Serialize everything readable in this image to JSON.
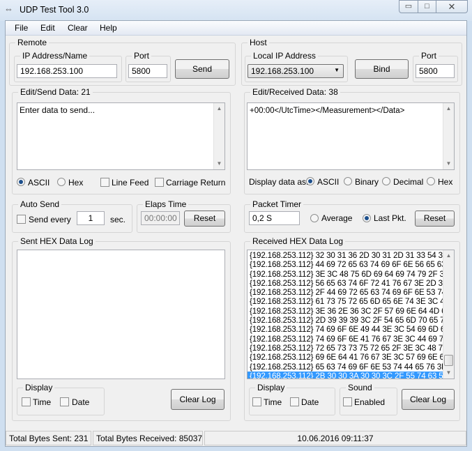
{
  "window": {
    "title": "UDP Test Tool 3.0",
    "controls": [
      "minimize",
      "maximize",
      "close"
    ]
  },
  "menu": [
    "File",
    "Edit",
    "Clear",
    "Help"
  ],
  "remote": {
    "label": "Remote",
    "ip_label": "IP Address/Name",
    "ip_value": "192.168.253.100",
    "port_label": "Port",
    "port_value": "5800",
    "send_label": "Send"
  },
  "host": {
    "label": "Host",
    "local_ip_label": "Local IP Address",
    "local_ip_value": "192.168.253.100",
    "bind_label": "Bind",
    "port_label": "Port",
    "port_value": "5800"
  },
  "edit_send": {
    "label": "Edit/Send Data: 21",
    "placeholder": "Enter data to send...",
    "ascii": "ASCII",
    "hex": "Hex",
    "line_feed": "Line Feed",
    "carriage_return": "Carriage Return",
    "selected": "ASCII"
  },
  "edit_received": {
    "label": "Edit/Received Data: 38",
    "text": "+00:00</UtcTime></Measurement></Data>",
    "display_as": "Display data as:",
    "options": [
      "ASCII",
      "Binary",
      "Decimal",
      "Hex"
    ],
    "selected": "ASCII"
  },
  "auto_send": {
    "label": "Auto Send",
    "send_every": "Send every",
    "interval": "1",
    "unit": "sec."
  },
  "elaps_time": {
    "label": "Elaps Time",
    "value": "00:00:00",
    "reset": "Reset"
  },
  "packet_timer": {
    "label": "Packet Timer",
    "value": "0,2 S",
    "average": "Average",
    "last_pkt": "Last Pkt.",
    "selected": "Last Pkt.",
    "reset": "Reset"
  },
  "sent_log": {
    "label": "Sent HEX Data Log",
    "display_label": "Display",
    "time": "Time",
    "date": "Date",
    "clear_log": "Clear Log"
  },
  "received_log": {
    "label": "Received HEX Data Log",
    "lines": [
      "{192.168.253.112} 32 30 31 36 2D 30 31 2D 31 33 54 31 3",
      "{192.168.253.112} 44 69 72 65 63 74 69 6F 6E 56 65 63 7",
      "{192.168.253.112} 3E 3C 48 75 6D 69 64 69 74 79 2F 3E",
      "{192.168.253.112} 56 65 63 74 6F 72 41 76 67 3E 2D 39 3",
      "{192.168.253.112} 2F 44 69 72 65 63 74 69 6F 6E 53 74 4",
      "{192.168.253.112} 61 73 75 72 65 6D 65 6E 74 3E 3C 4D",
      "{192.168.253.112} 3E 36 2E 36 3C 2F 57 69 6E 64 4D 61",
      "{192.168.253.112} 2D 39 39 39 3C 2F 54 65 6D 70 65 72",
      "{192.168.253.112} 74 69 6F 6E 49 44 3E 3C 54 69 6D 65",
      "{192.168.253.112} 74 69 6F 6E 41 76 67 3E 3C 44 69 72 6",
      "{192.168.253.112} 72 65 73 73 75 72 65 2F 3E 3C 48 75 6",
      "{192.168.253.112} 69 6E 64 41 76 67 3E 3C 57 69 6E 64 5",
      "{192.168.253.112} 65 63 74 69 6F 6E 53 74 44 65 76 3E 3",
      "{192.168.253.112} 2B 30 30 3A 30 30 3C 2F 55 74 63 54 6"
    ],
    "selected_index": 13,
    "display_label": "Display",
    "time": "Time",
    "date": "Date",
    "sound_label": "Sound",
    "enabled": "Enabled",
    "clear_log": "Clear Log"
  },
  "status": {
    "sent": "Total Bytes Sent: 231",
    "received": "Total Bytes Received: 85037",
    "datetime": "10.06.2016 09:11:37"
  }
}
